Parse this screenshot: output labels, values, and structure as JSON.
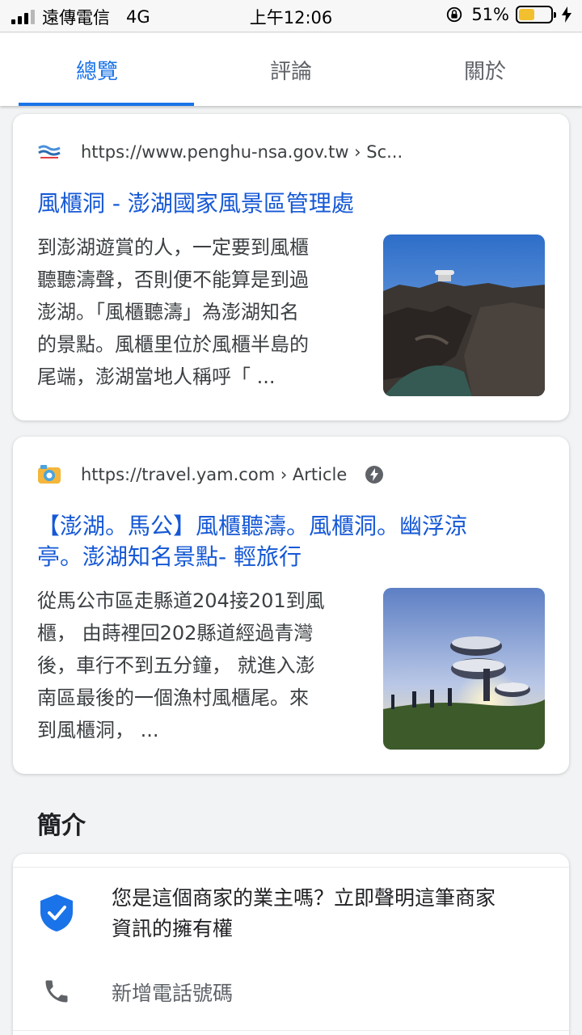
{
  "status_bar": {
    "carrier": "遠傳電信",
    "network": "4G",
    "time": "上午12:06",
    "battery_percent": "51%",
    "battery_level": 0.51
  },
  "tabs": [
    {
      "label": "總覽",
      "active": true
    },
    {
      "label": "評論",
      "active": false
    },
    {
      "label": "關於",
      "active": false
    }
  ],
  "results": [
    {
      "url": "https://www.penghu-nsa.gov.tw › Sc...",
      "title": "風櫃洞 - 澎湖國家風景區管理處",
      "snippet_lines": [
        "到澎湖遊賞的人，一定要到風櫃",
        "聽聽濤聲，否則便不能算是到過",
        "澎湖。「風櫃聽濤」為澎湖知名",
        "的景點。風櫃里位於風櫃半島的",
        "尾端，澎湖當地人稱呼「 ..."
      ],
      "thumbnail": "coastal-rocks-photo"
    },
    {
      "url": "https://travel.yam.com › Article",
      "title_lines": [
        "【澎湖。馬公】風櫃聽濤。風櫃洞。幽浮涼",
        "亭。澎湖知名景點- 輕旅行"
      ],
      "snippet_lines": [
        "從馬公市區走縣道204接201到風",
        "櫃， 由蒔裡回202縣道經過青灣",
        "後，車行不到五分鐘， 就進入澎",
        "南區最後的一個漁村風櫃尾。來",
        "到風櫃洞， ..."
      ],
      "thumbnail": "ufo-pavilion-sunset-photo",
      "amp": true
    }
  ],
  "section": {
    "title": "簡介"
  },
  "info": {
    "claim_lines": [
      "您是這個商家的業主嗎？立即聲明這筆商家",
      "資訊的擁有權"
    ],
    "add_phone": "新增電話號碼"
  },
  "colors": {
    "accent": "#1a73e8",
    "link": "#1558d6",
    "battery": "#f2c02e"
  }
}
